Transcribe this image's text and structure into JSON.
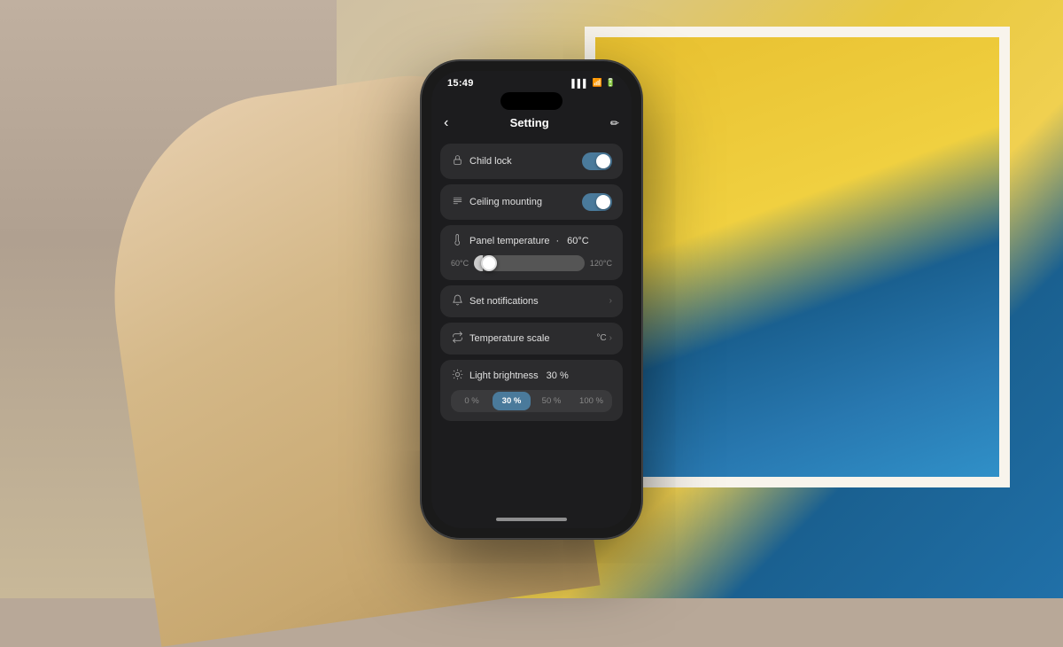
{
  "background": {
    "colors": {
      "left": "#c0b0a0",
      "art_frame": "#f8f4ec",
      "art_bg": "#e8c030",
      "art_accent": "#1a6090"
    }
  },
  "phone": {
    "status_bar": {
      "time": "15:49",
      "signal_icon": "signal",
      "wifi_icon": "wifi",
      "battery_icon": "battery"
    },
    "nav": {
      "back_icon": "chevron-left",
      "title": "Setting",
      "edit_icon": "pencil"
    },
    "settings": {
      "child_lock": {
        "icon": "lock",
        "label": "Child lock",
        "toggle_state": "on"
      },
      "ceiling_mounting": {
        "icon": "grid",
        "label": "Ceiling mounting",
        "toggle_state": "on"
      },
      "panel_temperature": {
        "icon": "thermometer",
        "label": "Panel temperature",
        "separator": "·",
        "value": "60°C",
        "min": "60°C",
        "max": "120°C",
        "slider_position_pct": 8
      },
      "set_notifications": {
        "icon": "bell",
        "label": "Set notifications",
        "chevron": "›"
      },
      "temperature_scale": {
        "icon": "arrows",
        "label": "Temperature scale",
        "value": "°C",
        "chevron": "›"
      },
      "light_brightness": {
        "icon": "sun",
        "label": "Light brightness",
        "value": "30 %",
        "options": [
          "0 %",
          "30 %",
          "50 %",
          "100 %"
        ],
        "active_option": "30 %"
      }
    }
  }
}
